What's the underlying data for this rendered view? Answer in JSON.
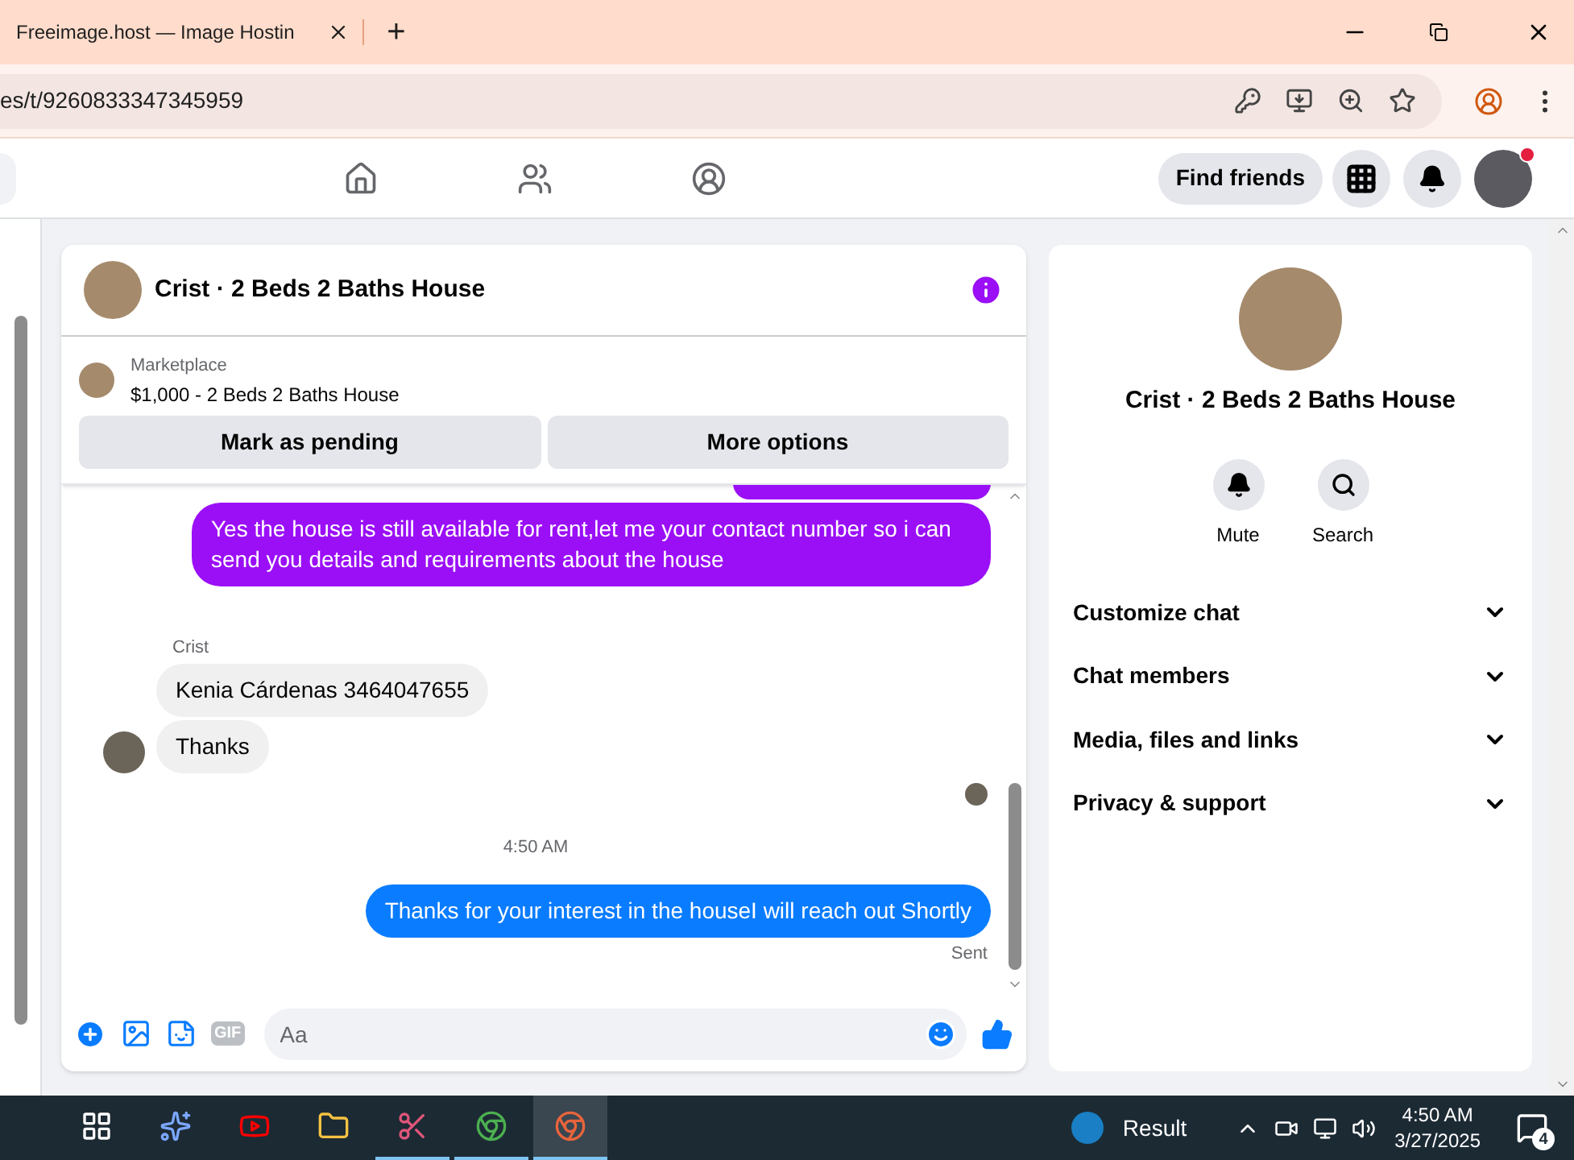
{
  "browser": {
    "tab_title": "Freeimage.host — Image Hostin",
    "new_tab": "+",
    "address": "es/t/9260833347345959"
  },
  "nav": {
    "icons": [
      {
        "kind": "home",
        "selected": false
      },
      {
        "kind": "friends",
        "selected": false
      },
      {
        "kind": "groups",
        "selected": false
      }
    ],
    "find_friends": "Find friends",
    "notification_badge": true
  },
  "chat": {
    "title": "Crist · 2 Beds 2 Baths House",
    "listing": {
      "source": "Marketplace",
      "name": "$1,000 - 2 Beds 2 Baths House"
    },
    "actions": [
      "Mark as pending",
      "More options"
    ],
    "messages": [
      {
        "kind": "sent",
        "color": "#9b0ff7",
        "text": "Yes the house is still available for rent,let me your contact number so i can send you details and requirements about the house"
      },
      {
        "kind": "sender",
        "text": "Crist"
      },
      {
        "kind": "received",
        "text": "Kenia Cárdenas 3464047655",
        "avatar": false
      },
      {
        "kind": "received",
        "text": "Thanks",
        "avatar": true
      },
      {
        "kind": "seen"
      },
      {
        "kind": "time",
        "text": "4:50 AM"
      },
      {
        "kind": "sent",
        "color": "#0a7cff",
        "text": "Thanks for your interest in the houseI will reach out Shortly"
      },
      {
        "kind": "status",
        "text": "Sent"
      }
    ],
    "composer": {
      "placeholder": "Aa",
      "gif": "GIF"
    }
  },
  "details": {
    "title": "Crist · 2 Beds 2 Baths House",
    "actions": [
      {
        "kind": "mute",
        "label": "Mute"
      },
      {
        "kind": "search",
        "label": "Search"
      }
    ],
    "sections": [
      {
        "label": "Customize chat",
        "expanded": false
      },
      {
        "label": "Chat members",
        "expanded": false
      },
      {
        "label": "Media, files and links",
        "expanded": false
      },
      {
        "label": "Privacy & support",
        "expanded": false
      }
    ]
  },
  "taskbar": {
    "apps": [
      {
        "kind": "taskview",
        "selected": false
      },
      {
        "kind": "copilot",
        "selected": false
      },
      {
        "kind": "youtube",
        "selected": false
      },
      {
        "kind": "folder",
        "selected": false
      },
      {
        "kind": "snip",
        "selected": false
      },
      {
        "kind": "chrome",
        "selected": false
      },
      {
        "kind": "chrome2",
        "selected": true
      }
    ],
    "weather": "Result",
    "time": "4:50 AM",
    "date": "3/27/2025",
    "notifications": "4"
  }
}
